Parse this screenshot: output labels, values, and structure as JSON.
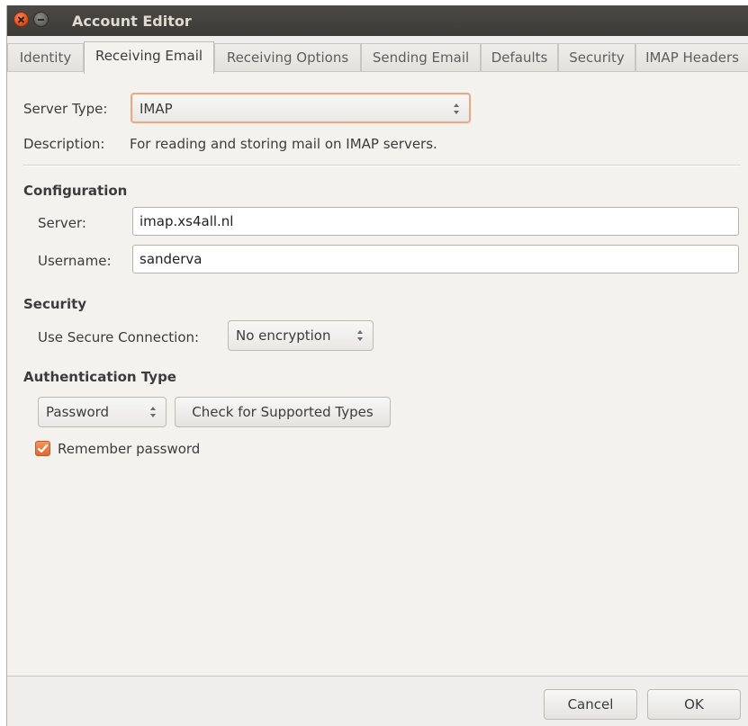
{
  "window": {
    "title": "Account Editor",
    "controls": [
      "close-icon",
      "minimize-icon"
    ]
  },
  "tabs": [
    {
      "label": "Identity",
      "active": false
    },
    {
      "label": "Receiving Email",
      "active": true
    },
    {
      "label": "Receiving Options",
      "active": false
    },
    {
      "label": "Sending Email",
      "active": false
    },
    {
      "label": "Defaults",
      "active": false
    },
    {
      "label": "Security",
      "active": false
    },
    {
      "label": "IMAP Headers",
      "active": false
    }
  ],
  "server_type": {
    "label": "Server Type:",
    "value": "IMAP"
  },
  "description": {
    "label": "Description:",
    "value": "For reading and storing mail on IMAP servers."
  },
  "configuration": {
    "heading": "Configuration",
    "server_label": "Server:",
    "server_value": "imap.xs4all.nl",
    "username_label": "Username:",
    "username_value": "sanderva"
  },
  "security": {
    "heading": "Security",
    "secure_connection_label": "Use Secure Connection:",
    "secure_connection_value": "No encryption"
  },
  "authentication": {
    "heading": "Authentication Type",
    "type_value": "Password",
    "check_button_label": "Check for Supported Types",
    "remember_password_label": "Remember password",
    "remember_password_checked": true
  },
  "footer": {
    "cancel_label": "Cancel",
    "ok_label": "OK"
  },
  "colors": {
    "accent": "#e06a2a",
    "titlebar": "#3c3b37",
    "window_bg": "#efeeec"
  }
}
